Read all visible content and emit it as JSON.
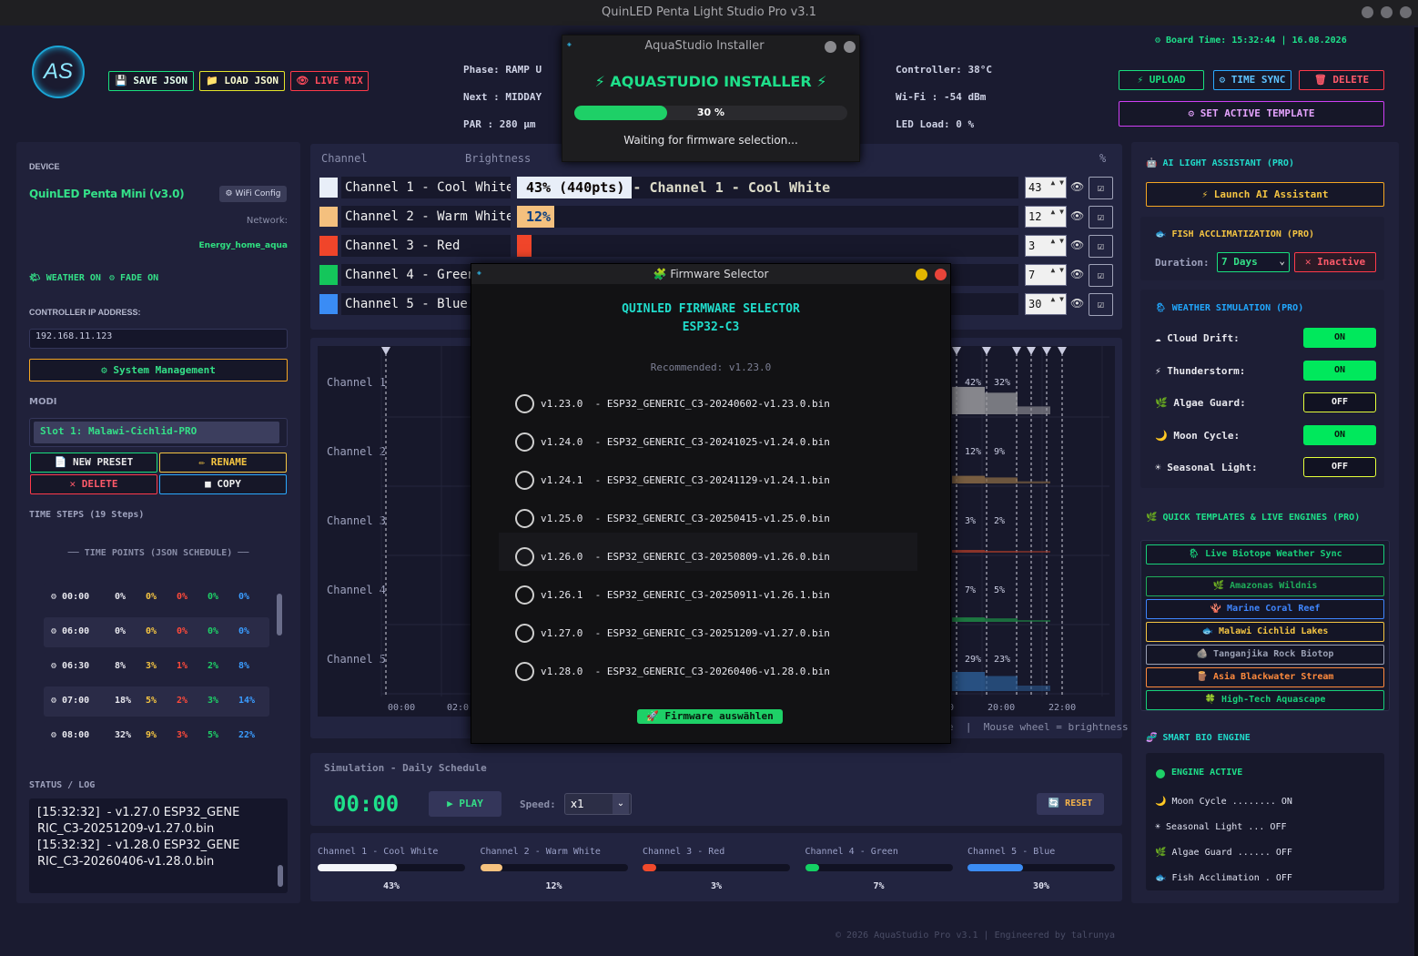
{
  "window": {
    "title": "QuinLED Penta Light Studio Pro v3.1"
  },
  "header": {
    "save_json": "💾 SAVE JSON",
    "load_json": "📁 LOAD JSON",
    "live_mix": "👁 LIVE MIX",
    "phase": "Phase: RAMP U",
    "next": "Next  : MIDDAY",
    "par": "PAR   : 280 µm",
    "controller": "Controller: 38°C",
    "wifi": "Wi-Fi  : -54 dBm",
    "led_load": "LED Load: 0 %",
    "board_time": "⚙ Board Time: 15:32:44 | 16.08.2026",
    "upload": "⚡ UPLOAD",
    "time_sync": "⚙ TIME SYNC",
    "delete": "🗑 DELETE",
    "set_template": "⚙ SET ACTIVE TEMPLATE",
    "icons": {
      "phase": "sun-icon",
      "next": "hourglass-icon",
      "par": "plant-icon",
      "controller": "thermometer-icon",
      "wifi": "wifi-icon",
      "led": "bulb-icon"
    }
  },
  "installer": {
    "title": "AquaStudio Installer",
    "heading": "⚡ AQUASTUDIO INSTALLER ⚡",
    "progress_label": "30 %",
    "progress": 0.3,
    "status": "Waiting for firmware selection..."
  },
  "left": {
    "device_label": "DEVICE",
    "device_name": "QuinLED Penta Mini (v3.0)",
    "wifi_config": "⚙ WiFi Config",
    "network_label": "Network:",
    "network_value": "Energy_home_aqua",
    "weather_on": "🌤 WEATHER ON",
    "fade_on": "⚙ FADE ON",
    "ip_label": "CONTROLLER IP ADDRESS:",
    "ip_value": "192.168.11.123",
    "system_mgmt": "⚙ System Management",
    "modi_label": "MODI",
    "slot": "Slot 1: Malawi-Cichlid-PRO",
    "new_preset": "📄 NEW PRESET",
    "rename": "✏ RENAME",
    "delete": "✕ DELETE",
    "copy": "■ COPY",
    "time_steps_label": "TIME STEPS (19 Steps)",
    "time_points_label": "── TIME POINTS (JSON SCHEDULE) ──",
    "steps": [
      {
        "time": "⚙ 00:00",
        "v": [
          "0%",
          "0%",
          "0%",
          "0%",
          "0%"
        ]
      },
      {
        "time": "⚙ 06:00",
        "v": [
          "0%",
          "0%",
          "0%",
          "0%",
          "0%"
        ]
      },
      {
        "time": "⚙ 06:30",
        "v": [
          "8%",
          "3%",
          "1%",
          "2%",
          "8%"
        ]
      },
      {
        "time": "⚙ 07:00",
        "v": [
          "18%",
          "5%",
          "2%",
          "3%",
          "14%"
        ]
      },
      {
        "time": "⚙ 08:00",
        "v": [
          "32%",
          "9%",
          "3%",
          "5%",
          "22%"
        ]
      }
    ],
    "status_label": "STATUS / LOG",
    "log": [
      "[15:32:32]  - v1.27.0 ESP32_GENE",
      "RIC_C3-20251209-v1.27.0.bin",
      "[15:32:32]  - v1.28.0 ESP32_GENE",
      "RIC_C3-20260406-v1.28.0.bin"
    ]
  },
  "channels": {
    "header_channel": "Channel",
    "header_brightness": "Brightness",
    "header_pct": "%",
    "rows": [
      {
        "name": "Channel 1 - Cool White",
        "color": "#e8eef8",
        "value": "43",
        "bar_text": "43% (440pts) - Channel 1 - Cool White",
        "level": 0.43
      },
      {
        "name": "Channel 2 - Warm White",
        "color": "#f4c07e",
        "value": "12",
        "bar_text": "12%",
        "level": 0.12
      },
      {
        "name": "Channel 3 - Red",
        "color": "#f0452a",
        "value": "3",
        "bar_text": "",
        "level": 0.03
      },
      {
        "name": "Channel 4 - Green",
        "color": "#14c65b",
        "value": "7",
        "bar_text": "",
        "level": 0.07
      },
      {
        "name": "Channel 5 - Blue",
        "color": "#3a8cf5",
        "value": "30",
        "bar_text": "",
        "level": 0.3
      }
    ]
  },
  "chart": {
    "row_labels": [
      "Channel 1",
      "Channel 2",
      "Channel 3",
      "Channel 4",
      "Channel 5"
    ],
    "x_ticks": [
      "00:00",
      "02:0",
      "0",
      "20:00",
      "22:00"
    ],
    "pct_left": [
      "42%",
      "12%",
      "3%",
      "7%",
      "29%"
    ],
    "pct_right": [
      "32%",
      "9%",
      "2%",
      "5%",
      "23%"
    ],
    "hint": "e  |  Mouse wheel = brightness"
  },
  "firmware": {
    "title": "🧩 Firmware Selector",
    "heading": "QUINLED FIRMWARE SELECTOR",
    "chip": "ESP32-C3",
    "recommended": "Recommended: v1.23.0",
    "items": [
      {
        "v": "v1.23.0",
        "file": "ESP32_GENERIC_C3-20240602-v1.23.0.bin"
      },
      {
        "v": "v1.24.0",
        "file": "ESP32_GENERIC_C3-20241025-v1.24.0.bin"
      },
      {
        "v": "v1.24.1",
        "file": "ESP32_GENERIC_C3-20241129-v1.24.1.bin"
      },
      {
        "v": "v1.25.0",
        "file": "ESP32_GENERIC_C3-20250415-v1.25.0.bin"
      },
      {
        "v": "v1.26.0",
        "file": "ESP32_GENERIC_C3-20250809-v1.26.0.bin"
      },
      {
        "v": "v1.26.1",
        "file": "ESP32_GENERIC_C3-20250911-v1.26.1.bin"
      },
      {
        "v": "v1.27.0",
        "file": "ESP32_GENERIC_C3-20251209-v1.27.0.bin"
      },
      {
        "v": "v1.28.0",
        "file": "ESP32_GENERIC_C3-20260406-v1.28.0.bin"
      }
    ],
    "select_button": "🚀 Firmware auswählen"
  },
  "simulation": {
    "title": "Simulation - Daily Schedule",
    "time": "00:00",
    "play": "▶ PLAY",
    "speed_label": "Speed:",
    "speed_value": "x1",
    "reset": "🔄 RESET",
    "bars": [
      {
        "name": "Channel 1 - Cool White",
        "pct": "43%",
        "level": 0.43,
        "color": "#f4f6fb"
      },
      {
        "name": "Channel 2 - Warm White",
        "pct": "12%",
        "level": 0.12,
        "color": "#f6c27f"
      },
      {
        "name": "Channel 3 - Red",
        "pct": "3%",
        "level": 0.03,
        "color": "#f04a2c"
      },
      {
        "name": "Channel 4 - Green",
        "pct": "7%",
        "level": 0.07,
        "color": "#14d164"
      },
      {
        "name": "Channel 5 - Blue",
        "pct": "30%",
        "level": 0.3,
        "color": "#3b8cf3"
      }
    ]
  },
  "right": {
    "ai_title": "🤖 AI LIGHT ASSISTANT (PRO)",
    "ai_button": "⚡ Launch AI Assistant",
    "fish_title": "🐟 FISH ACCLIMATIZATION (PRO)",
    "duration_label": "Duration:",
    "duration_value": "7 Days",
    "inactive": "✕ Inactive",
    "weather_title": "🌦 WEATHER SIMULATION (PRO)",
    "weather": [
      {
        "label": "☁ Cloud Drift:",
        "state": "ON"
      },
      {
        "label": "⚡ Thunderstorm:",
        "state": "ON"
      },
      {
        "label": "🌿 Algae Guard:",
        "state": "OFF"
      },
      {
        "label": "🌙 Moon Cycle:",
        "state": "ON"
      },
      {
        "label": "☀ Seasonal Light:",
        "state": "OFF"
      }
    ],
    "templates_title": "🌿 QUICK TEMPLATES & LIVE ENGINES (PRO)",
    "templates": [
      {
        "label": "🌦 Live Biotope Weather Sync",
        "color": "#18d07a"
      },
      {
        "label": "🌿 Amazonas Wildnis",
        "color": "#1fae5a"
      },
      {
        "label": "🪸 Marine Coral Reef",
        "color": "#3f86ff"
      },
      {
        "label": "🐟 Malawi Cichlid Lakes",
        "color": "#f5c542"
      },
      {
        "label": "🪨 Tanganjika Rock Biotop",
        "color": "#9aa0b4"
      },
      {
        "label": "🪵 Asia Blackwater Stream",
        "color": "#ff8a3d"
      },
      {
        "label": "🍀 High-Tech Aquascape",
        "color": "#18d07a"
      }
    ],
    "bio_title": "🧬 SMART BIO ENGINE",
    "engine_active": "ENGINE ACTIVE",
    "bio": [
      "🌙 Moon Cycle ........ ON",
      "☀ Seasonal Light ... OFF",
      "🌿 Algae Guard ...... OFF",
      "🐟 Fish Acclimation . OFF"
    ]
  },
  "footer": "© 2026 AquaStudio Pro v3.1 | Engineered by talrunya"
}
